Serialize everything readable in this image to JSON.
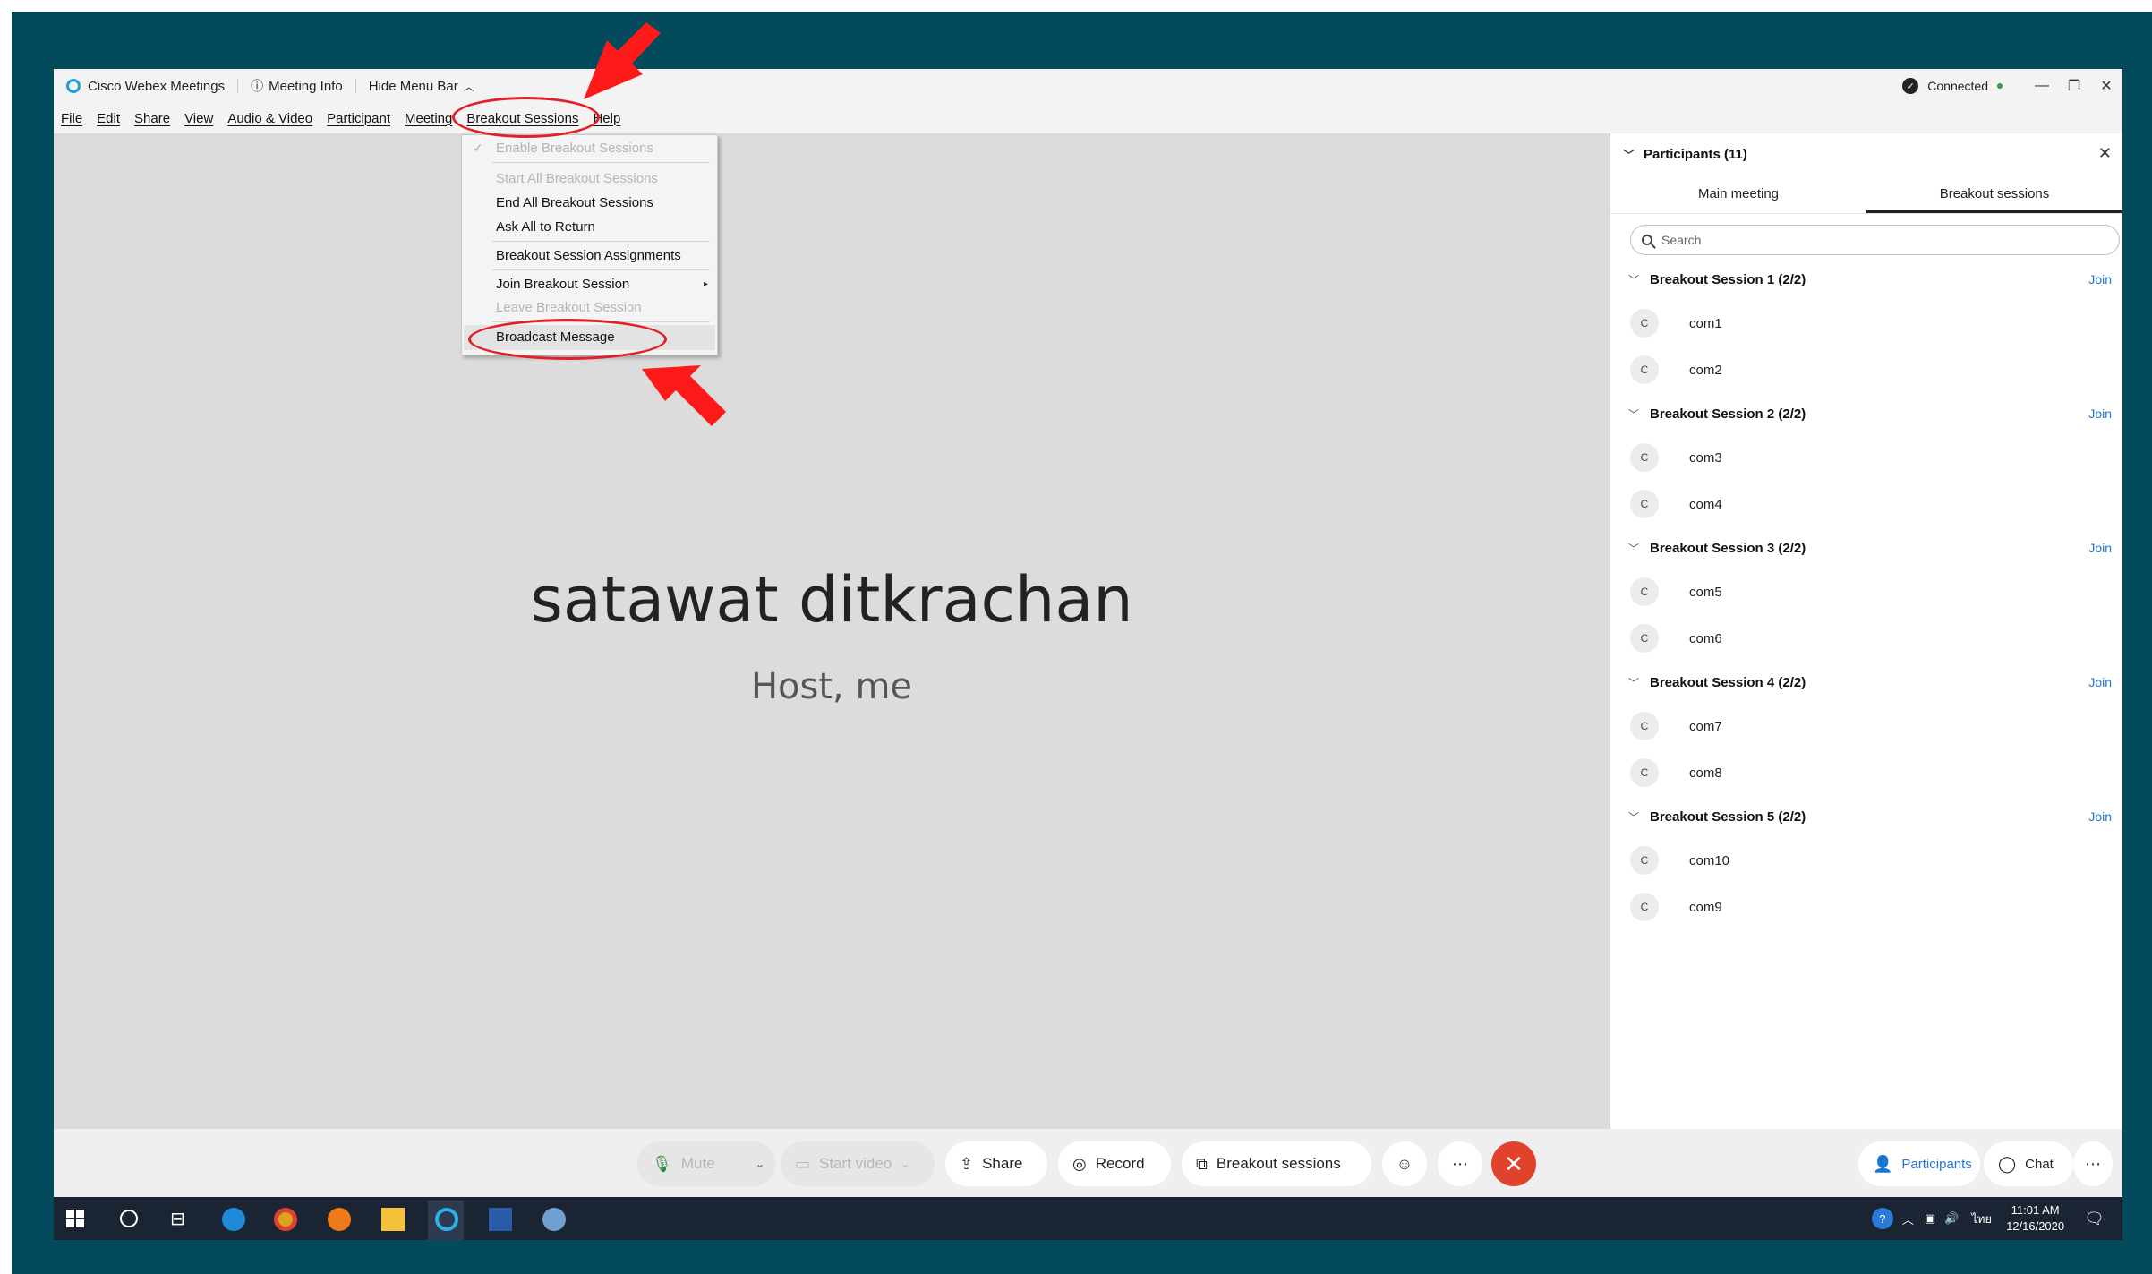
{
  "window": {
    "app_title": "Cisco Webex Meetings",
    "meeting_info": "Meeting Info",
    "hide_menu": "Hide Menu Bar",
    "status": "Connected"
  },
  "menubar": {
    "items": [
      {
        "label": "File"
      },
      {
        "label": "Edit"
      },
      {
        "label": "Share"
      },
      {
        "label": "View"
      },
      {
        "label": "Audio & Video"
      },
      {
        "label": "Participant"
      },
      {
        "label": "Meeting"
      },
      {
        "label": "Breakout Sessions"
      },
      {
        "label": "Help"
      }
    ]
  },
  "dropdown": {
    "items": [
      {
        "label": "Enable Breakout Sessions",
        "enabled": false
      },
      {
        "label": "Start All Breakout Sessions",
        "enabled": false
      },
      {
        "label": "End All Breakout Sessions",
        "enabled": true
      },
      {
        "label": "Ask All to Return",
        "enabled": true
      },
      {
        "label": "Breakout Session Assignments",
        "enabled": true
      },
      {
        "label": "Join Breakout Session",
        "enabled": true
      },
      {
        "label": "Leave Breakout Session",
        "enabled": false
      },
      {
        "label": "Broadcast Message",
        "enabled": true
      }
    ]
  },
  "stage": {
    "name": "satawat ditkrachan",
    "role": "Host, me"
  },
  "panel": {
    "title": "Participants (11)",
    "tabs": [
      {
        "label": "Main meeting"
      },
      {
        "label": "Breakout sessions",
        "active": true
      }
    ],
    "search_placeholder": "Search",
    "join_label": "Join",
    "groups": [
      {
        "name": "Breakout Session 1 (2/2)",
        "members": [
          {
            "initial": "C",
            "name": "com1"
          },
          {
            "initial": "C",
            "name": "com2"
          }
        ]
      },
      {
        "name": "Breakout Session 2 (2/2)",
        "members": [
          {
            "initial": "C",
            "name": "com3"
          },
          {
            "initial": "C",
            "name": "com4"
          }
        ]
      },
      {
        "name": "Breakout Session 3 (2/2)",
        "members": [
          {
            "initial": "C",
            "name": "com5"
          },
          {
            "initial": "C",
            "name": "com6"
          }
        ]
      },
      {
        "name": "Breakout Session 4 (2/2)",
        "members": [
          {
            "initial": "C",
            "name": "com7"
          },
          {
            "initial": "C",
            "name": "com8"
          }
        ]
      },
      {
        "name": "Breakout Session 5 (2/2)",
        "members": [
          {
            "initial": "C",
            "name": "com10"
          },
          {
            "initial": "C",
            "name": "com9"
          }
        ]
      }
    ]
  },
  "controls": {
    "mute": "Mute",
    "start_video": "Start video",
    "share": "Share",
    "record": "Record",
    "breakout": "Breakout sessions",
    "participants": "Participants",
    "chat": "Chat",
    "more": "⋯"
  },
  "taskbar": {
    "time": "11:01 AM",
    "date": "12/16/2020",
    "lang": "ไทย"
  },
  "colors": {
    "frame": "#034a5c",
    "annotation": "#e3202a",
    "link": "#1f75d1",
    "end_call": "#e0432b"
  }
}
